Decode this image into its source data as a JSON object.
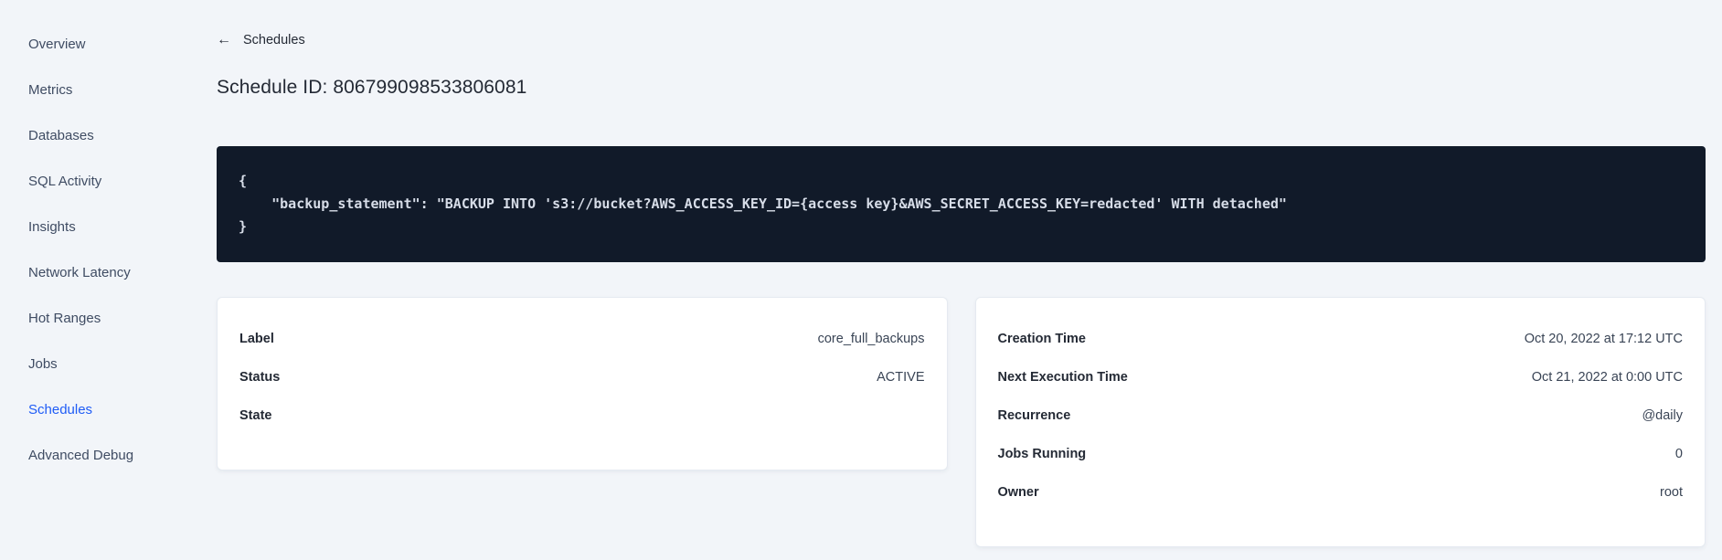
{
  "sidebar": {
    "items": [
      {
        "label": "Overview",
        "active": false
      },
      {
        "label": "Metrics",
        "active": false
      },
      {
        "label": "Databases",
        "active": false
      },
      {
        "label": "SQL Activity",
        "active": false
      },
      {
        "label": "Insights",
        "active": false
      },
      {
        "label": "Network Latency",
        "active": false
      },
      {
        "label": "Hot Ranges",
        "active": false
      },
      {
        "label": "Jobs",
        "active": false
      },
      {
        "label": "Schedules",
        "active": true
      },
      {
        "label": "Advanced Debug",
        "active": false
      }
    ]
  },
  "main": {
    "back_arrow": "←",
    "back_link_label": "Schedules",
    "page_title": "Schedule ID: 806799098533806081",
    "code_block": {
      "lines": [
        "{",
        "    \"backup_statement\": \"BACKUP INTO 's3://bucket?AWS_ACCESS_KEY_ID={access key}&AWS_SECRET_ACCESS_KEY=redacted' WITH detached\"",
        "}"
      ]
    },
    "details_card": {
      "rows": [
        {
          "label": "Label",
          "value": "core_full_backups"
        },
        {
          "label": "Status",
          "value": "ACTIVE"
        },
        {
          "label": "State",
          "value": ""
        }
      ]
    },
    "schedule_card": {
      "rows": [
        {
          "label": "Creation Time",
          "value": "Oct 20, 2022 at 17:12 UTC"
        },
        {
          "label": "Next Execution Time",
          "value": "Oct 21, 2022 at 0:00 UTC"
        },
        {
          "label": "Recurrence",
          "value": "@daily"
        },
        {
          "label": "Jobs Running",
          "value": "0"
        },
        {
          "label": "Owner",
          "value": "root"
        }
      ]
    }
  },
  "colors": {
    "page_background": "#f2f5f9",
    "sidebar_text": "#3f4c63",
    "active_link": "#1f5cf6",
    "heading_text": "#242a35",
    "code_background": "#111a29",
    "code_text": "#d7dde8",
    "card_background": "#ffffff",
    "card_border": "#e5eaf1"
  }
}
